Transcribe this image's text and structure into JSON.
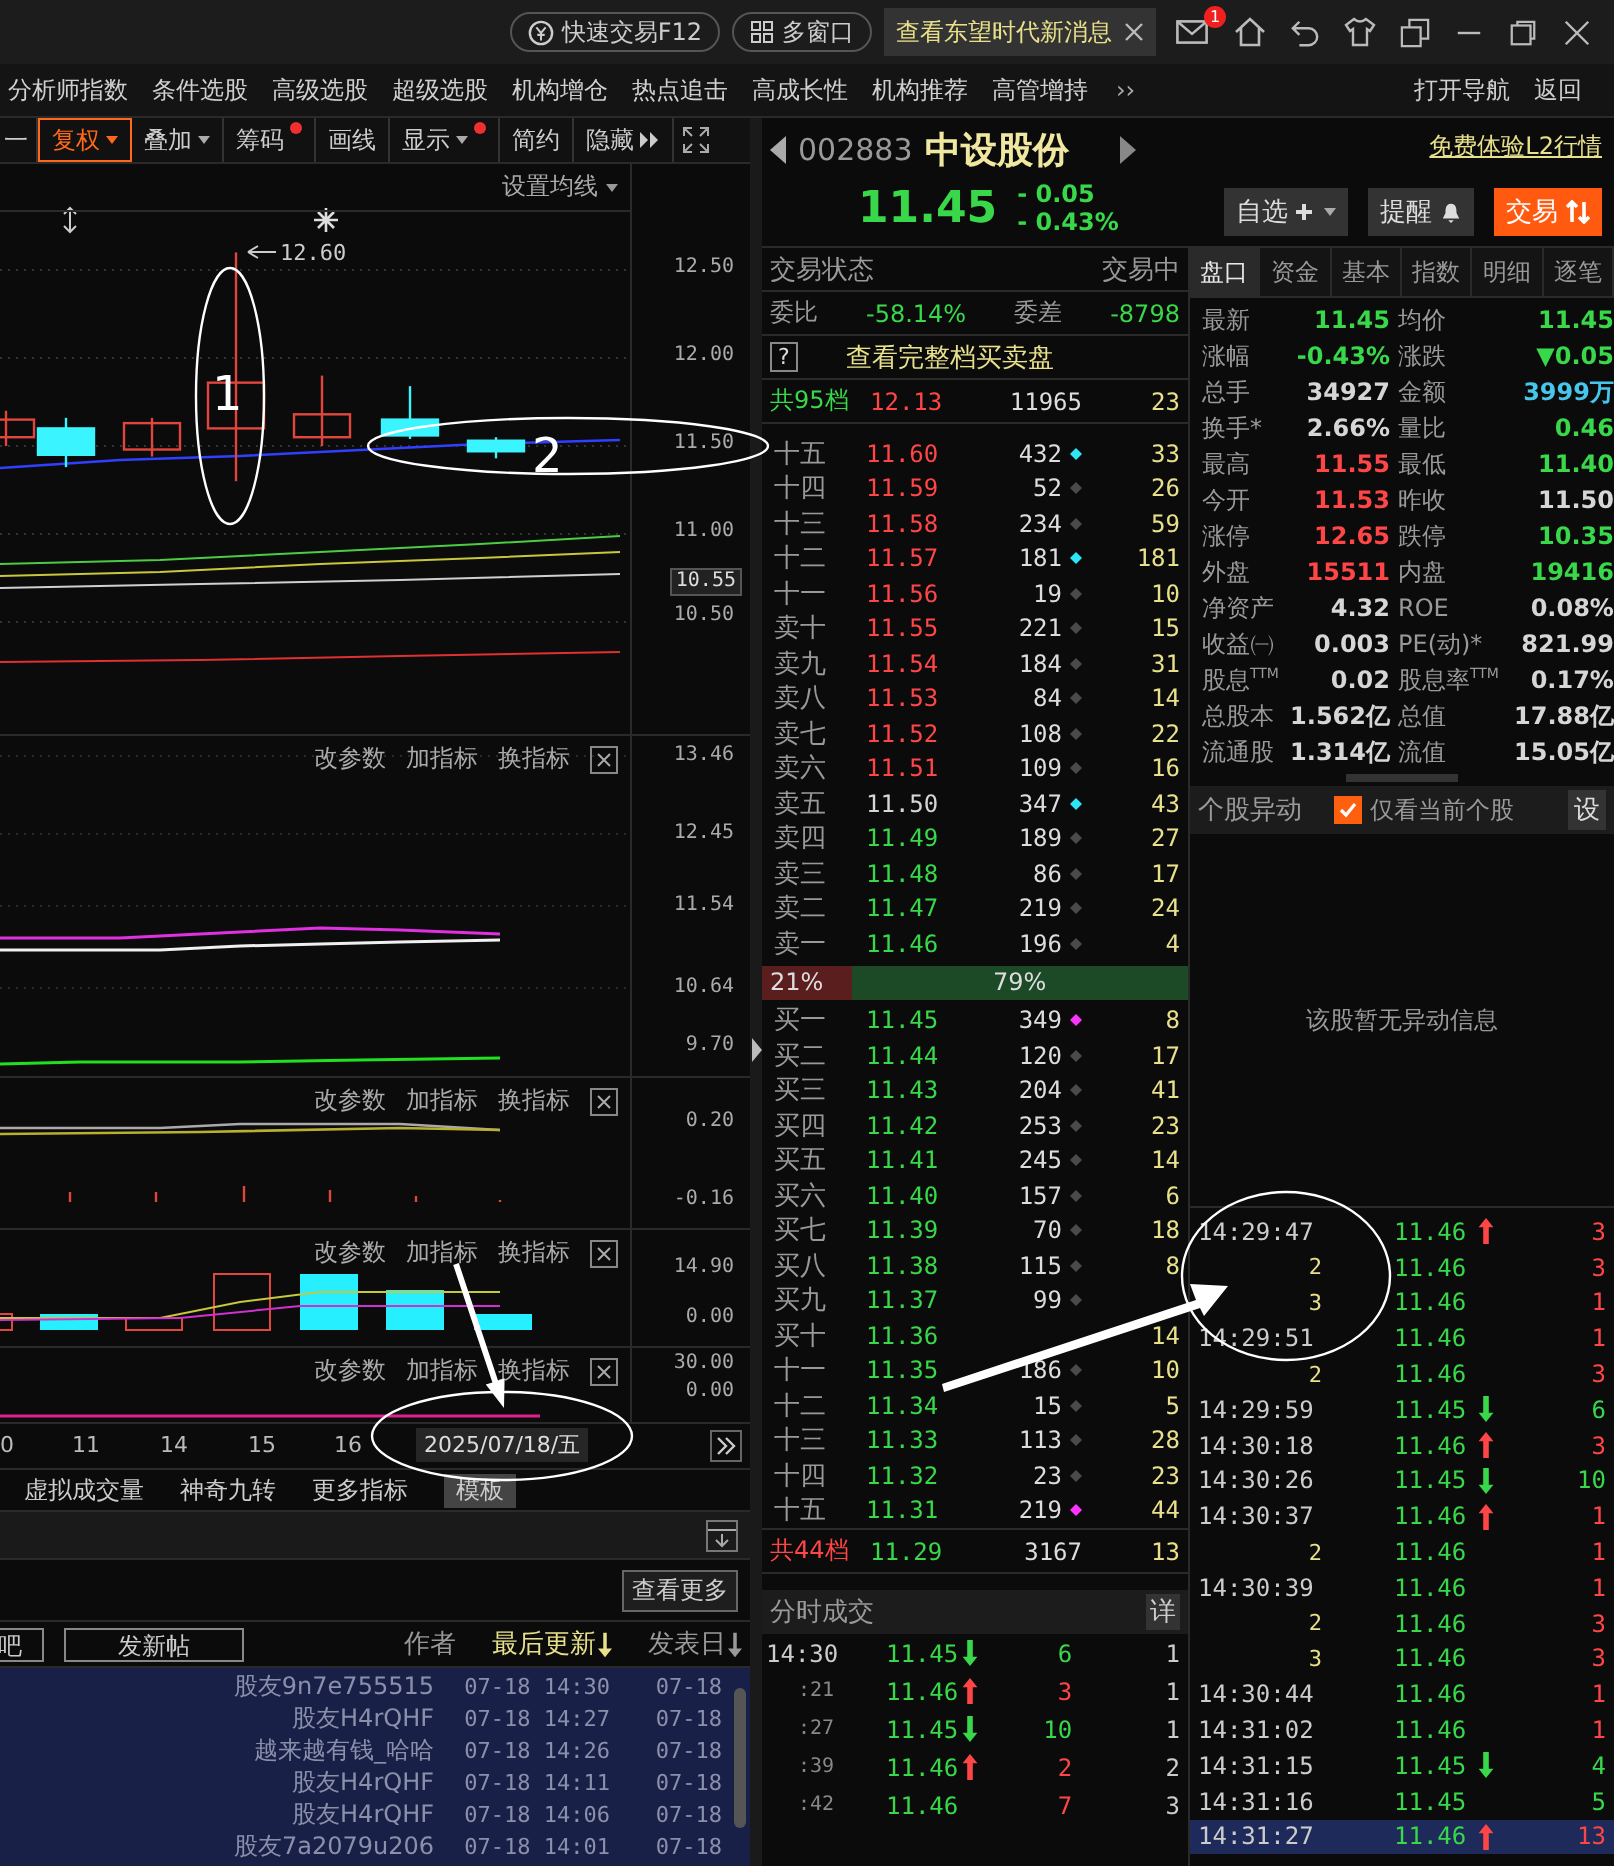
{
  "title_bar": {
    "quick_trade": "快速交易F12",
    "multi_window": "多窗口",
    "news_tab": "查看东望时代新消息",
    "mail_badge": "1"
  },
  "menu": {
    "items": [
      "分析师指数",
      "条件选股",
      "高级选股",
      "超级选股",
      "机构增仓",
      "热点追击",
      "高成长性",
      "机构推荐",
      "高管增持"
    ],
    "more": "››",
    "right_items": [
      "打开导航",
      "返回"
    ]
  },
  "toolbar": [
    {
      "label": "一",
      "kind": "plain",
      "selected": false,
      "dot": false
    },
    {
      "label": "复权",
      "kind": "menu",
      "selected": true,
      "dot": false
    },
    {
      "label": "叠加",
      "kind": "menu",
      "selected": false,
      "dot": false
    },
    {
      "label": "筹码",
      "kind": "plain",
      "selected": false,
      "dot": true
    },
    {
      "label": "画线",
      "kind": "plain",
      "selected": false,
      "dot": false
    },
    {
      "label": "显示",
      "kind": "menu",
      "selected": false,
      "dot": true
    },
    {
      "label": "简约",
      "kind": "plain",
      "selected": false,
      "dot": false
    },
    {
      "label": "隐藏",
      "kind": "more",
      "selected": false,
      "dot": false
    }
  ],
  "main_chart": {
    "ma_setting": "设置均线",
    "high_label": "12.60",
    "ticks": [
      {
        "label": "12.50",
        "highlighted": false
      },
      {
        "label": "12.00",
        "highlighted": false
      },
      {
        "label": "11.50",
        "highlighted": false
      },
      {
        "label": "11.00",
        "highlighted": false
      },
      {
        "label": "10.55",
        "highlighted": true
      },
      {
        "label": "10.50",
        "highlighted": false
      }
    ]
  },
  "indicators": [
    {
      "actions": [
        "改参数",
        "加指标",
        "换指标"
      ],
      "ticks": [
        "13.46",
        "12.45",
        "11.54",
        "10.64",
        "9.70"
      ]
    },
    {
      "actions": [
        "改参数",
        "加指标",
        "换指标"
      ],
      "ticks": [
        "0.20",
        "-0.16"
      ]
    },
    {
      "actions": [
        "改参数",
        "加指标",
        "换指标"
      ],
      "ticks": [
        "14.90",
        "0.00"
      ]
    },
    {
      "actions": [
        "改参数",
        "加指标",
        "换指标"
      ],
      "ticks": [
        "30.00",
        "0.00"
      ]
    }
  ],
  "date_axis": {
    "labels": [
      "0",
      "11",
      "14",
      "15",
      "16"
    ],
    "cursor_date": "2025/07/18/五"
  },
  "bottom_tabs": [
    {
      "label": "虚拟成交量",
      "selected": false
    },
    {
      "label": "神奇九转",
      "selected": false
    },
    {
      "label": "更多指标",
      "selected": false
    },
    {
      "label": "模板",
      "selected": true
    }
  ],
  "forum": {
    "more": "查看更多",
    "bar_button": "吧",
    "new_post": "发新帖",
    "columns": [
      {
        "label": "作者",
        "selected": false,
        "sort_arrow": false
      },
      {
        "label": "最后更新",
        "selected": true,
        "sort_arrow": true
      },
      {
        "label": "发表日",
        "selected": false,
        "sort_arrow": true
      }
    ],
    "rows": [
      {
        "author": "股友9n7e755515",
        "updated": "07-18 14:30",
        "posted": "07-18"
      },
      {
        "author": "股友H4rQHF",
        "updated": "07-18 14:27",
        "posted": "07-18"
      },
      {
        "author": "越来越有钱_哈哈",
        "updated": "07-18 14:26",
        "posted": "07-18"
      },
      {
        "author": "股友H4rQHF",
        "updated": "07-18 14:11",
        "posted": "07-18"
      },
      {
        "author": "股友H4rQHF",
        "updated": "07-18 14:06",
        "posted": "07-18"
      },
      {
        "author": "股友7a2079u206",
        "updated": "07-18 14:01",
        "posted": "07-18"
      }
    ]
  },
  "quote": {
    "code": "002883",
    "name": "中设股份",
    "price": "11.45",
    "change": "- 0.05",
    "change_pct": "- 0.43%",
    "color": "#38d84a",
    "l2_link": "免费体验L2行情",
    "buttons": [
      {
        "label": "自选",
        "kind": "watch"
      },
      {
        "label": "提醒",
        "kind": "alert"
      },
      {
        "label": "交易",
        "kind": "trade"
      }
    ]
  },
  "order_book": {
    "status_label": "交易状态",
    "status": "交易中",
    "ratio_label": "委比",
    "ratio": "-58.14%",
    "diff_label": "委差",
    "diff": "-8798",
    "help": "?",
    "full_book": "查看完整档买卖盘",
    "ask_total": {
      "label": "共95档",
      "price": "12.13",
      "volume": "11965",
      "count": "23"
    },
    "asks": [
      {
        "label": "十五",
        "price": "11.60",
        "volume": "432",
        "count": "33",
        "color": "#ff4646",
        "dot": {
          "color": "#2ee6f5"
        }
      },
      {
        "label": "十四",
        "price": "11.59",
        "volume": "52",
        "count": "26",
        "color": "#ff4646",
        "dot": {
          "color": "#4a4a4a"
        }
      },
      {
        "label": "十三",
        "price": "11.58",
        "volume": "234",
        "count": "59",
        "color": "#ff4646",
        "dot": {
          "color": "#4a4a4a"
        }
      },
      {
        "label": "十二",
        "price": "11.57",
        "volume": "181",
        "count": "181",
        "color": "#ff4646",
        "dot": {
          "color": "#2ee6f5"
        }
      },
      {
        "label": "十一",
        "price": "11.56",
        "volume": "19",
        "count": "10",
        "color": "#ff4646",
        "dot": {
          "color": "#4a4a4a"
        }
      },
      {
        "label": "卖十",
        "price": "11.55",
        "volume": "221",
        "count": "15",
        "color": "#ff4646",
        "dot": {
          "color": "#4a4a4a"
        }
      },
      {
        "label": "卖九",
        "price": "11.54",
        "volume": "184",
        "count": "31",
        "color": "#ff4646",
        "dot": {
          "color": "#4a4a4a"
        }
      },
      {
        "label": "卖八",
        "price": "11.53",
        "volume": "84",
        "count": "14",
        "color": "#ff4646",
        "dot": {
          "color": "#4a4a4a"
        }
      },
      {
        "label": "卖七",
        "price": "11.52",
        "volume": "108",
        "count": "22",
        "color": "#ff4646",
        "dot": {
          "color": "#4a4a4a"
        }
      },
      {
        "label": "卖六",
        "price": "11.51",
        "volume": "109",
        "count": "16",
        "color": "#ff4646",
        "dot": {
          "color": "#4a4a4a"
        }
      },
      {
        "label": "卖五",
        "price": "11.50",
        "volume": "347",
        "count": "43",
        "color": "#d6d6d6",
        "dot": {
          "color": "#2ee6f5"
        }
      },
      {
        "label": "卖四",
        "price": "11.49",
        "volume": "189",
        "count": "27",
        "color": "#38d84a",
        "dot": {
          "color": "#4a4a4a"
        }
      },
      {
        "label": "卖三",
        "price": "11.48",
        "volume": "86",
        "count": "17",
        "color": "#38d84a",
        "dot": {
          "color": "#4a4a4a"
        }
      },
      {
        "label": "卖二",
        "price": "11.47",
        "volume": "219",
        "count": "24",
        "color": "#38d84a",
        "dot": {
          "color": "#4a4a4a"
        }
      },
      {
        "label": "卖一",
        "price": "11.46",
        "volume": "196",
        "count": "4",
        "color": "#38d84a",
        "dot": {
          "color": "#4a4a4a"
        }
      }
    ],
    "balance": {
      "sell_share": "21%",
      "buy_share": "79%",
      "level": 0.21
    },
    "bids": [
      {
        "label": "买一",
        "price": "11.45",
        "volume": "349",
        "count": "8",
        "color": "#38d84a",
        "dot": {
          "color": "#ff33ff"
        }
      },
      {
        "label": "买二",
        "price": "11.44",
        "volume": "120",
        "count": "17",
        "color": "#38d84a",
        "dot": {
          "color": "#4a4a4a"
        }
      },
      {
        "label": "买三",
        "price": "11.43",
        "volume": "204",
        "count": "41",
        "color": "#38d84a",
        "dot": {
          "color": "#4a4a4a"
        }
      },
      {
        "label": "买四",
        "price": "11.42",
        "volume": "253",
        "count": "23",
        "color": "#38d84a",
        "dot": {
          "color": "#4a4a4a"
        }
      },
      {
        "label": "买五",
        "price": "11.41",
        "volume": "245",
        "count": "14",
        "color": "#38d84a",
        "dot": {
          "color": "#4a4a4a"
        }
      },
      {
        "label": "买六",
        "price": "11.40",
        "volume": "157",
        "count": "6",
        "color": "#38d84a",
        "dot": {
          "color": "#4a4a4a"
        }
      },
      {
        "label": "买七",
        "price": "11.39",
        "volume": "70",
        "count": "18",
        "color": "#38d84a",
        "dot": {
          "color": "#4a4a4a"
        }
      },
      {
        "label": "买八",
        "price": "11.38",
        "volume": "115",
        "count": "8",
        "color": "#38d84a",
        "dot": {
          "color": "#4a4a4a"
        }
      },
      {
        "label": "买九",
        "price": "11.37",
        "volume": "99",
        "color": "#38d84a",
        "dot": {
          "color": "#4a4a4a"
        }
      },
      {
        "label": "买十",
        "price": "11.36",
        "count": "14",
        "color": "#38d84a"
      },
      {
        "label": "十一",
        "price": "11.35",
        "volume": "186",
        "count": "10",
        "color": "#38d84a",
        "dot": {
          "color": "#4a4a4a"
        }
      },
      {
        "label": "十二",
        "price": "11.34",
        "volume": "15",
        "count": "5",
        "color": "#38d84a",
        "dot": {
          "color": "#4a4a4a"
        }
      },
      {
        "label": "十三",
        "price": "11.33",
        "volume": "113",
        "count": "28",
        "color": "#38d84a",
        "dot": {
          "color": "#4a4a4a"
        }
      },
      {
        "label": "十四",
        "price": "11.32",
        "volume": "23",
        "count": "23",
        "color": "#38d84a",
        "dot": {
          "color": "#4a4a4a"
        }
      },
      {
        "label": "十五",
        "price": "11.31",
        "volume": "219",
        "count": "44",
        "color": "#38d84a",
        "dot": {
          "color": "#ff33ff"
        }
      }
    ],
    "bid_total": {
      "label": "共44档",
      "price": "11.29",
      "volume": "3167",
      "count": "13"
    }
  },
  "minute_trades": {
    "title": "分时成交",
    "detail": "详",
    "rows": [
      {
        "time": "14:30",
        "kind": "minute",
        "price": "11.45",
        "up_arrow": false,
        "down_arrow": true,
        "volume": "6",
        "color": "#38d84a",
        "count": "1"
      },
      {
        "time": ":21",
        "kind": "second",
        "price": "11.46",
        "up_arrow": true,
        "down_arrow": false,
        "volume": "3",
        "color": "#ff4646",
        "count": "1"
      },
      {
        "time": ":27",
        "kind": "second",
        "price": "11.45",
        "up_arrow": false,
        "down_arrow": true,
        "volume": "10",
        "color": "#38d84a",
        "count": "1"
      },
      {
        "time": ":39",
        "kind": "second",
        "price": "11.46",
        "up_arrow": true,
        "down_arrow": false,
        "volume": "2",
        "color": "#ff4646",
        "count": "2"
      },
      {
        "time": ":42",
        "kind": "second",
        "price": "11.46",
        "up_arrow": false,
        "down_arrow": false,
        "volume": "7",
        "color": "#ff4646",
        "count": "3"
      }
    ]
  },
  "panel": {
    "tabs": [
      {
        "label": "盘口",
        "selected": true
      },
      {
        "label": "资金",
        "selected": false
      },
      {
        "label": "基本",
        "selected": false
      },
      {
        "label": "指数",
        "selected": false
      },
      {
        "label": "明细",
        "selected": false
      },
      {
        "label": "逐笔",
        "selected": false
      }
    ],
    "stats": [
      {
        "label": "最新",
        "value": "11.45",
        "color": "#38d84a"
      },
      {
        "label": "均价",
        "value": "11.45",
        "color": "#38d84a"
      },
      {
        "label": "涨幅",
        "value": "-0.43%",
        "color": "#38d84a"
      },
      {
        "label": "涨跌",
        "value": "▼0.05",
        "color": "#38d84a"
      },
      {
        "label": "总手",
        "value": "34927",
        "color": "#d6d6d6"
      },
      {
        "label": "金额",
        "value": "3999万",
        "color": "#46c6ea"
      },
      {
        "label": "换手*",
        "value": "2.66%",
        "color": "#d6d6d6"
      },
      {
        "label": "量比",
        "value": "0.46",
        "color": "#38d84a"
      },
      {
        "label": "最高",
        "value": "11.55",
        "color": "#ff4646"
      },
      {
        "label": "最低",
        "value": "11.40",
        "color": "#38d84a"
      },
      {
        "label": "今开",
        "value": "11.53",
        "color": "#ff4646"
      },
      {
        "label": "昨收",
        "value": "11.50",
        "color": "#d6d6d6"
      },
      {
        "label": "涨停",
        "value": "12.65",
        "color": "#ff4646"
      },
      {
        "label": "跌停",
        "value": "10.35",
        "color": "#38d84a"
      },
      {
        "label": "外盘",
        "value": "15511",
        "color": "#ff4646"
      },
      {
        "label": "内盘",
        "value": "19416",
        "color": "#38d84a"
      },
      {
        "label": "净资产",
        "value": "4.32",
        "color": "#d6d6d6"
      },
      {
        "label": "ROE",
        "value": "0.08%",
        "color": "#d6d6d6"
      },
      {
        "label": "收益㈠",
        "value": "0.003",
        "color": "#d6d6d6"
      },
      {
        "label": "PE(动)*",
        "value": "821.99",
        "color": "#d6d6d6"
      },
      {
        "label": "股息$^{TTM}$",
        "value": "0.02",
        "color": "#d6d6d6"
      },
      {
        "label": "股息率$^{TTM}$",
        "value": "0.17%",
        "color": "#d6d6d6"
      },
      {
        "label": "总股本",
        "value": "1.562亿",
        "color": "#d6d6d6"
      },
      {
        "label": "总值",
        "value": "17.88亿",
        "color": "#d6d6d6"
      },
      {
        "label": "流通股",
        "value": "1.314亿",
        "color": "#d6d6d6"
      },
      {
        "label": "流值",
        "value": "15.05亿",
        "color": "#d6d6d6"
      }
    ]
  },
  "alerts": {
    "title": "个股异动",
    "only_current": {
      "label": "仅看当前个股",
      "checked": true
    },
    "settings": "设",
    "empty": "该股暂无异动信息"
  },
  "ticks": [
    {
      "time": "14:29:47",
      "kind": "time",
      "price": "11.46",
      "up_arrow": true,
      "down_arrow": false,
      "volume": "3",
      "color": "#ff4646",
      "selected": false
    },
    {
      "time": "2",
      "kind": "seq",
      "price": "11.46",
      "up_arrow": false,
      "down_arrow": false,
      "volume": "3",
      "color": "#ff4646",
      "selected": false
    },
    {
      "time": "3",
      "kind": "seq",
      "price": "11.46",
      "up_arrow": false,
      "down_arrow": false,
      "volume": "1",
      "color": "#ff4646",
      "selected": false
    },
    {
      "time": "14:29:51",
      "kind": "time",
      "price": "11.46",
      "up_arrow": false,
      "down_arrow": false,
      "volume": "1",
      "color": "#ff4646",
      "selected": false
    },
    {
      "time": "2",
      "kind": "seq",
      "price": "11.46",
      "up_arrow": false,
      "down_arrow": false,
      "volume": "3",
      "color": "#ff4646",
      "selected": false
    },
    {
      "time": "14:29:59",
      "kind": "time",
      "price": "11.45",
      "up_arrow": false,
      "down_arrow": true,
      "volume": "6",
      "color": "#38d84a",
      "selected": false
    },
    {
      "time": "14:30:18",
      "kind": "time",
      "price": "11.46",
      "up_arrow": true,
      "down_arrow": false,
      "volume": "3",
      "color": "#ff4646",
      "selected": false
    },
    {
      "time": "14:30:26",
      "kind": "time",
      "price": "11.45",
      "up_arrow": false,
      "down_arrow": true,
      "volume": "10",
      "color": "#38d84a",
      "selected": false
    },
    {
      "time": "14:30:37",
      "kind": "time",
      "price": "11.46",
      "up_arrow": true,
      "down_arrow": false,
      "volume": "1",
      "color": "#ff4646",
      "selected": false
    },
    {
      "time": "2",
      "kind": "seq",
      "price": "11.46",
      "up_arrow": false,
      "down_arrow": false,
      "volume": "1",
      "color": "#ff4646",
      "selected": false
    },
    {
      "time": "14:30:39",
      "kind": "time",
      "price": "11.46",
      "up_arrow": false,
      "down_arrow": false,
      "volume": "1",
      "color": "#ff4646",
      "selected": false
    },
    {
      "time": "2",
      "kind": "seq",
      "price": "11.46",
      "up_arrow": false,
      "down_arrow": false,
      "volume": "3",
      "color": "#ff4646",
      "selected": false
    },
    {
      "time": "3",
      "kind": "seq",
      "price": "11.46",
      "up_arrow": false,
      "down_arrow": false,
      "volume": "3",
      "color": "#ff4646",
      "selected": false
    },
    {
      "time": "14:30:44",
      "kind": "time",
      "price": "11.46",
      "up_arrow": false,
      "down_arrow": false,
      "volume": "1",
      "color": "#ff4646",
      "selected": false
    },
    {
      "time": "14:31:02",
      "kind": "time",
      "price": "11.46",
      "up_arrow": false,
      "down_arrow": false,
      "volume": "1",
      "color": "#ff4646",
      "selected": false
    },
    {
      "time": "14:31:15",
      "kind": "time",
      "price": "11.45",
      "up_arrow": false,
      "down_arrow": true,
      "volume": "4",
      "color": "#38d84a",
      "selected": false
    },
    {
      "time": "14:31:16",
      "kind": "time",
      "price": "11.45",
      "up_arrow": false,
      "down_arrow": false,
      "volume": "5",
      "color": "#38d84a",
      "selected": false
    },
    {
      "time": "14:31:27",
      "kind": "time",
      "price": "11.46",
      "up_arrow": true,
      "down_arrow": false,
      "volume": "13",
      "color": "#ff4646",
      "selected": true
    }
  ],
  "annotations": [
    {
      "label": "1"
    },
    {
      "label": "2"
    }
  ]
}
